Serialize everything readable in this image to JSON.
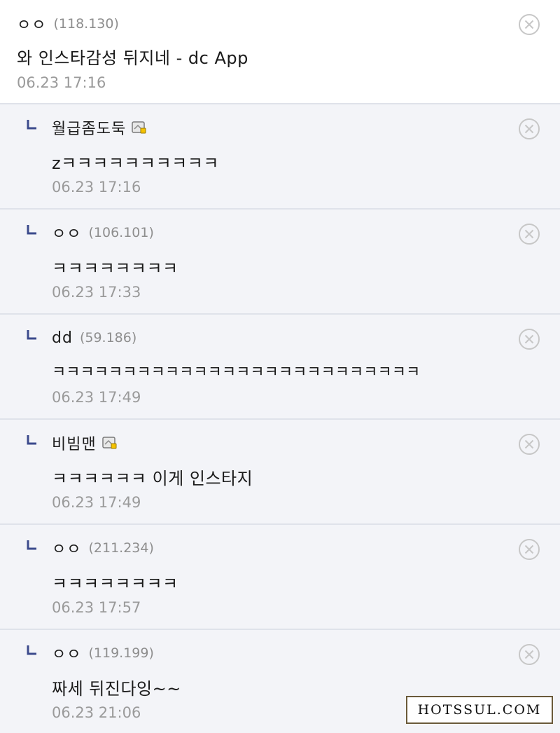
{
  "comments": [
    {
      "author": "ㅇㅇ",
      "ip": "(118.130)",
      "content": "와 인스타감성 뒤지네 - dc App",
      "date": "06.23 17:16"
    },
    {
      "author": "월급좀도둑",
      "ip": "",
      "content": "zㅋㅋㅋㅋㅋㅋㅋㅋㅋㅋ",
      "date": "06.23 17:16"
    },
    {
      "author": "ㅇㅇ",
      "ip": "(106.101)",
      "content": "ㅋㅋㅋㅋㅋㅋㅋㅋ",
      "date": "06.23 17:33"
    },
    {
      "author": "dd",
      "ip": "(59.186)",
      "content": "ㅋㅋㅋㅋㅋㅋㅋㅋㅋㅋㅋㅋㅋㅋㅋㅋㅋㅋㅋㅋㅋㅋㅋㅋㅋㅋ",
      "date": "06.23 17:49"
    },
    {
      "author": "비빔맨",
      "ip": "",
      "content": "ㅋㅋㅋㅋㅋㅋ 이게 인스타지",
      "date": "06.23 17:49"
    },
    {
      "author": "ㅇㅇ",
      "ip": "(211.234)",
      "content": "ㅋㅋㅋㅋㅋㅋㅋㅋ",
      "date": "06.23 17:57"
    },
    {
      "author": "ㅇㅇ",
      "ip": "(119.199)",
      "content": "짜세 뒤진다잉~~",
      "date": "06.23 21:06"
    }
  ],
  "icons": {
    "delete": "close-circle-icon",
    "reply": "reply-arrow-icon",
    "member_badge": "gallery-member-icon"
  },
  "colors": {
    "reply_background": "#f3f4f8",
    "divider": "#dfe2ea",
    "reply_marker": "#3b4a8c",
    "date_text": "#9a9a9a",
    "ip_text": "#8e8e8e"
  },
  "watermark": {
    "text": "HOTSSUL.COM"
  }
}
